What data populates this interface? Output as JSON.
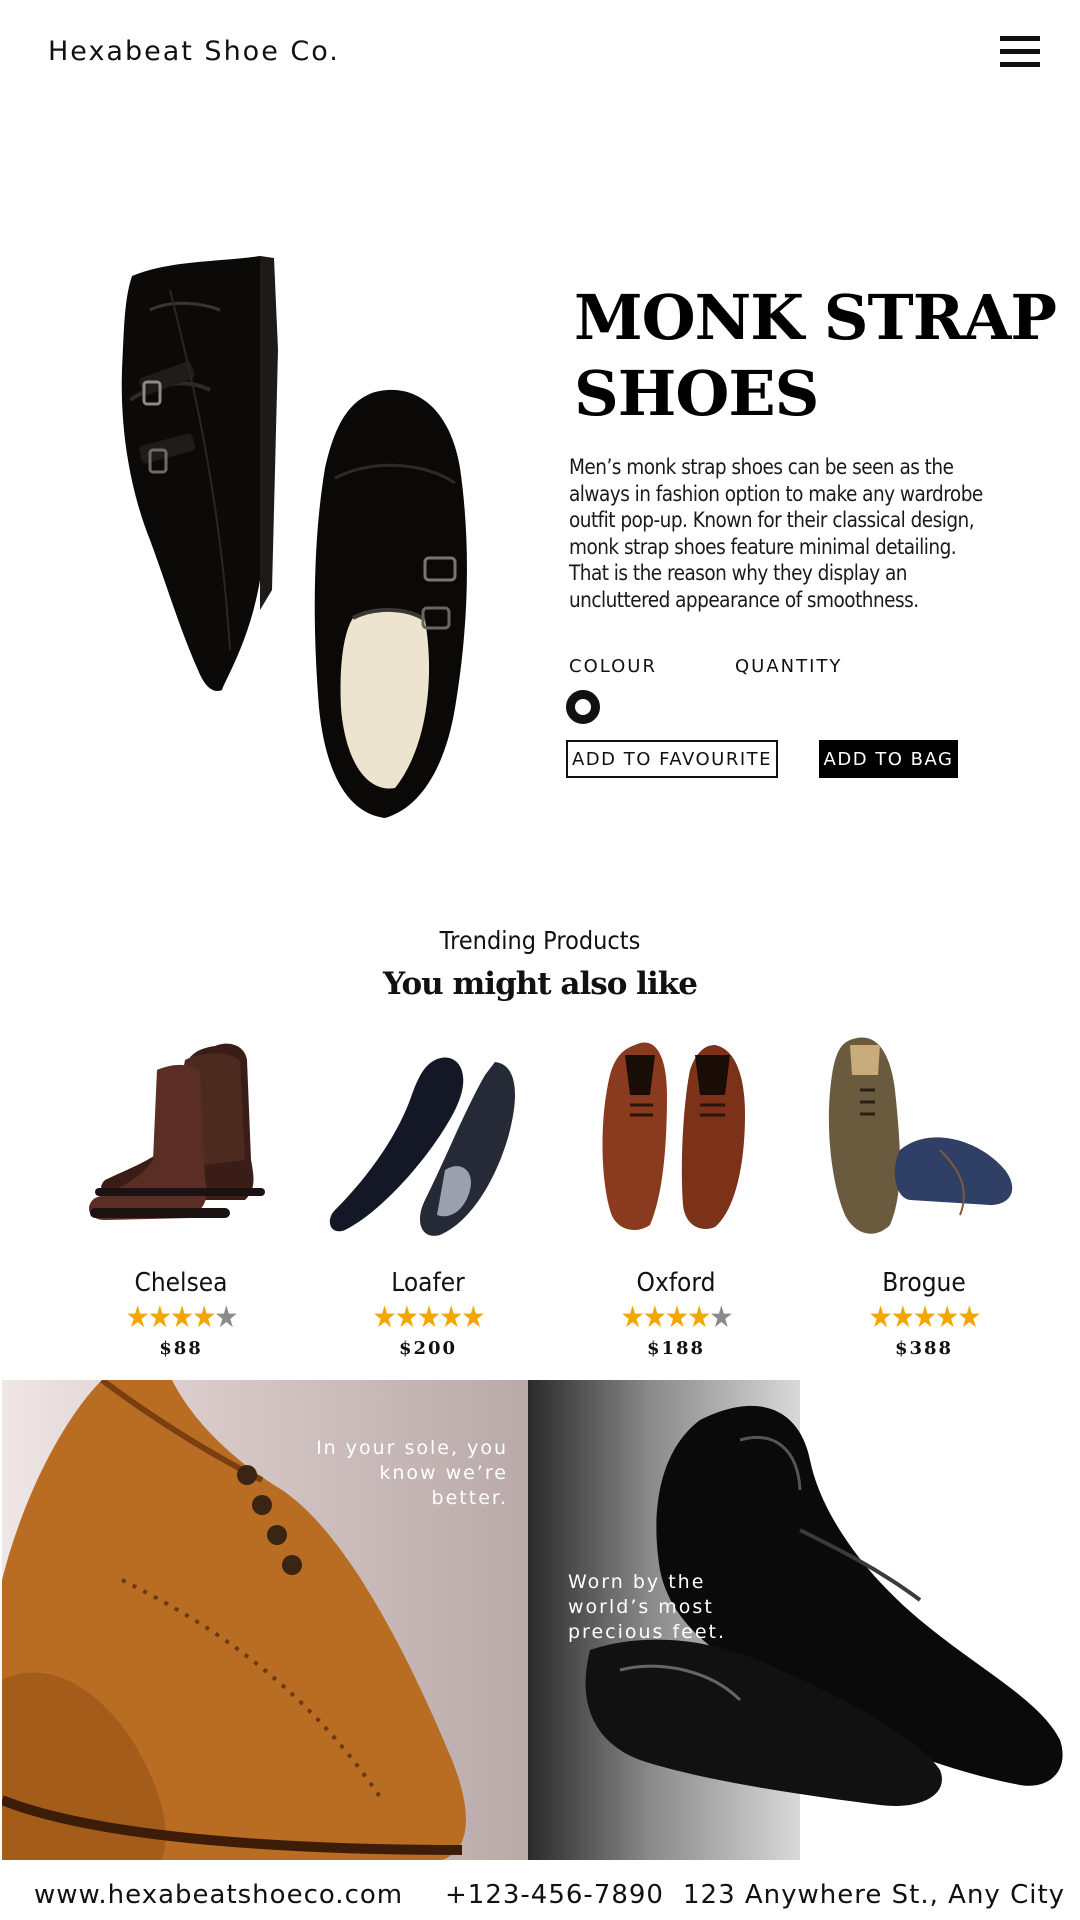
{
  "header": {
    "brand": "Hexabeat Shoe Co.",
    "menu_icon": "hamburger-icon"
  },
  "hero": {
    "title_line1": "MONK STRAP",
    "title_line2": "SHOES",
    "description": "Men’s monk strap shoes can be seen as the always in fashion option to make any wardrobe outfit pop-up. Known for their classical design, monk strap shoes feature minimal detailing. That is the reason why they display an uncluttered appearance of smoothness.",
    "colour_label": "COLOUR",
    "quantity_label": "QUANTITY",
    "selected_colour": "#111111",
    "add_favourite_label": "ADD TO FAVOURITE",
    "add_bag_label": "ADD TO BAG"
  },
  "trending": {
    "subtitle": "Trending Products",
    "title": "You might also like",
    "products": [
      {
        "name": "Chelsea",
        "rating": 4,
        "price": "$88"
      },
      {
        "name": "Loafer",
        "rating": 5,
        "price": "$200"
      },
      {
        "name": "Oxford",
        "rating": 4,
        "price": "$188"
      },
      {
        "name": "Brogue",
        "rating": 5,
        "price": "$388"
      }
    ]
  },
  "banners": {
    "left_quote": "In your sole, you know we’re better.",
    "left_quote_l1": "In your sole, you",
    "left_quote_l2": "know we’re",
    "left_quote_l3": "better.",
    "right_quote_l1": "Worn by the",
    "right_quote_l2": "world’s most",
    "right_quote_l3": "precious feet."
  },
  "footer": {
    "website": "www.hexabeatshoeco.com",
    "phone": "+123-456-7890",
    "address": "123 Anywhere St., Any City"
  },
  "colors": {
    "star": "#f2a600",
    "star_off": "#8a8a8a",
    "button_dark": "#000000"
  }
}
